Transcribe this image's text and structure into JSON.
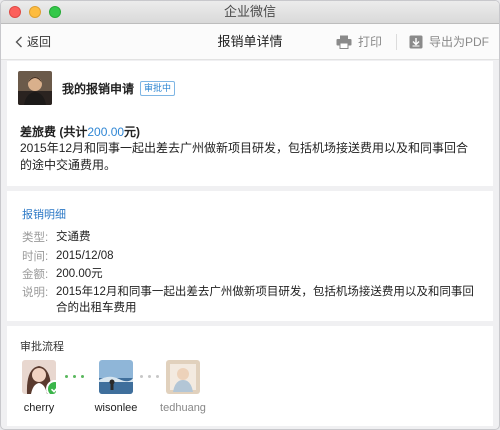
{
  "window": {
    "title": "企业微信"
  },
  "nav": {
    "back_label": "返回",
    "title": "报销单详情",
    "print_label": "打印",
    "export_label": "导出为PDF"
  },
  "applicant": {
    "name": "我的报销申请",
    "status": "审批中"
  },
  "expense": {
    "title_prefix": "差旅费 (共计",
    "total": "200.00",
    "title_suffix": "元)",
    "description": "2015年12月和同事一起出差去广州做新项目研发，包括机场接送费用以及和同事回合的途中交通费用。"
  },
  "detail": {
    "heading": "报销明细",
    "rows": [
      {
        "label": "类型:",
        "value": "交通费"
      },
      {
        "label": "时间:",
        "value": "2015/12/08"
      },
      {
        "label": "金额:",
        "value": "200.00元"
      },
      {
        "label": "说明:",
        "value": "2015年12月和同事一起出差去广州做新项目研发，包括机场接送费用以及和同事回合的出租车费用"
      }
    ]
  },
  "flow": {
    "heading": "审批流程",
    "approvers": [
      {
        "name": "cherry",
        "status": "approved"
      },
      {
        "name": "wisonlee",
        "status": "current"
      },
      {
        "name": "tedhuang",
        "status": "pending"
      }
    ]
  },
  "colors": {
    "accent": "#2f86d4",
    "approved": "#3ab54a"
  }
}
